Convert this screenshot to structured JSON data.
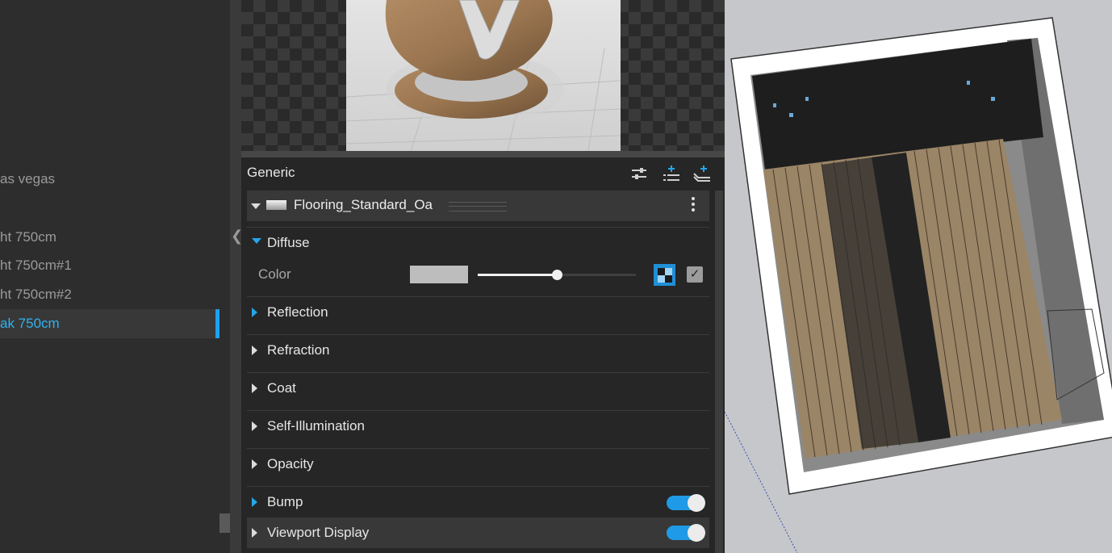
{
  "outliner": {
    "items": [
      {
        "label": "as vegas",
        "active": false
      },
      {
        "label": "ht 750cm",
        "active": false
      },
      {
        "label": "ht 750cm#1",
        "active": false
      },
      {
        "label": "ht 750cm#2",
        "active": false
      },
      {
        "label": "ak 750cm",
        "active": true
      }
    ]
  },
  "editor": {
    "header_title": "Generic",
    "header_icons": [
      "sliders-icon",
      "add-layer-icon",
      "add-to-scene-icon"
    ],
    "material_name": "Flooring_Standard_Oa",
    "diffuse": {
      "label": "Diffuse",
      "color_label": "Color",
      "color_hex": "#bdbdbd",
      "slider_fraction": 0.5,
      "enabled": true
    },
    "sections": [
      {
        "label": "Reflection"
      },
      {
        "label": "Refraction"
      },
      {
        "label": "Coat"
      },
      {
        "label": "Self-Illumination"
      },
      {
        "label": "Opacity"
      },
      {
        "label": "Bump",
        "toggle": true
      },
      {
        "label": "Viewport Display",
        "toggle": true
      }
    ]
  },
  "colors": {
    "accent": "#1f9ae6",
    "panel_bg": "#262626",
    "viewport_bg": "#c6c7ca"
  }
}
